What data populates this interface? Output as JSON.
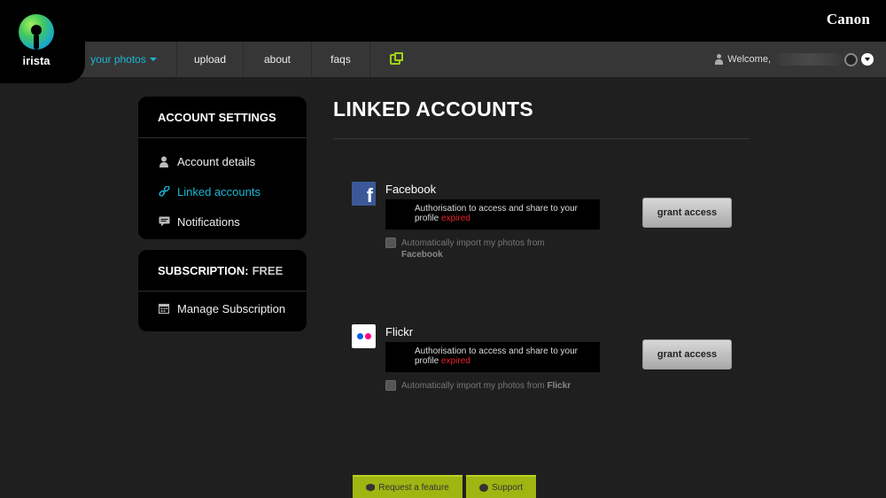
{
  "app": {
    "logo_text": "irista",
    "brand": "Canon"
  },
  "nav": {
    "items": [
      {
        "label": "your photos",
        "name": "nav-your-photos"
      },
      {
        "label": "upload",
        "name": "nav-upload"
      },
      {
        "label": "about",
        "name": "nav-about"
      },
      {
        "label": "faqs",
        "name": "nav-faqs"
      }
    ],
    "welcome": "Welcome,"
  },
  "sidebar": {
    "account_title": "ACCOUNT SETTINGS",
    "account_items": [
      {
        "label": "Account details",
        "icon": "user-icon"
      },
      {
        "label": "Linked accounts",
        "icon": "link-icon"
      },
      {
        "label": "Notifications",
        "icon": "notification-icon"
      }
    ],
    "subscription_title": "SUBSCRIPTION:",
    "subscription_plan": "FREE",
    "subscription_items": [
      {
        "label": "Manage Subscription",
        "icon": "calendar-icon"
      }
    ]
  },
  "main": {
    "title": "LINKED ACCOUNTS",
    "accounts": [
      {
        "service": "Facebook",
        "auth_text": "Authorisation to access and share to your profile",
        "status": "expired",
        "import_label": "Automatically import my photos from",
        "import_service": "Facebook",
        "button": "grant access"
      },
      {
        "service": "Flickr",
        "auth_text": "Authorisation to access and share to your profile",
        "status": "expired",
        "import_label": "Automatically import my photos from",
        "import_service": "Flickr",
        "button": "grant access"
      }
    ]
  },
  "footer": {
    "request_label": "Request a feature",
    "support_label": "Support"
  },
  "colors": {
    "accent": "#1ab7d4",
    "expired": "#e8232b",
    "footer_green": "#9eb512",
    "facebook": "#3b5998"
  }
}
